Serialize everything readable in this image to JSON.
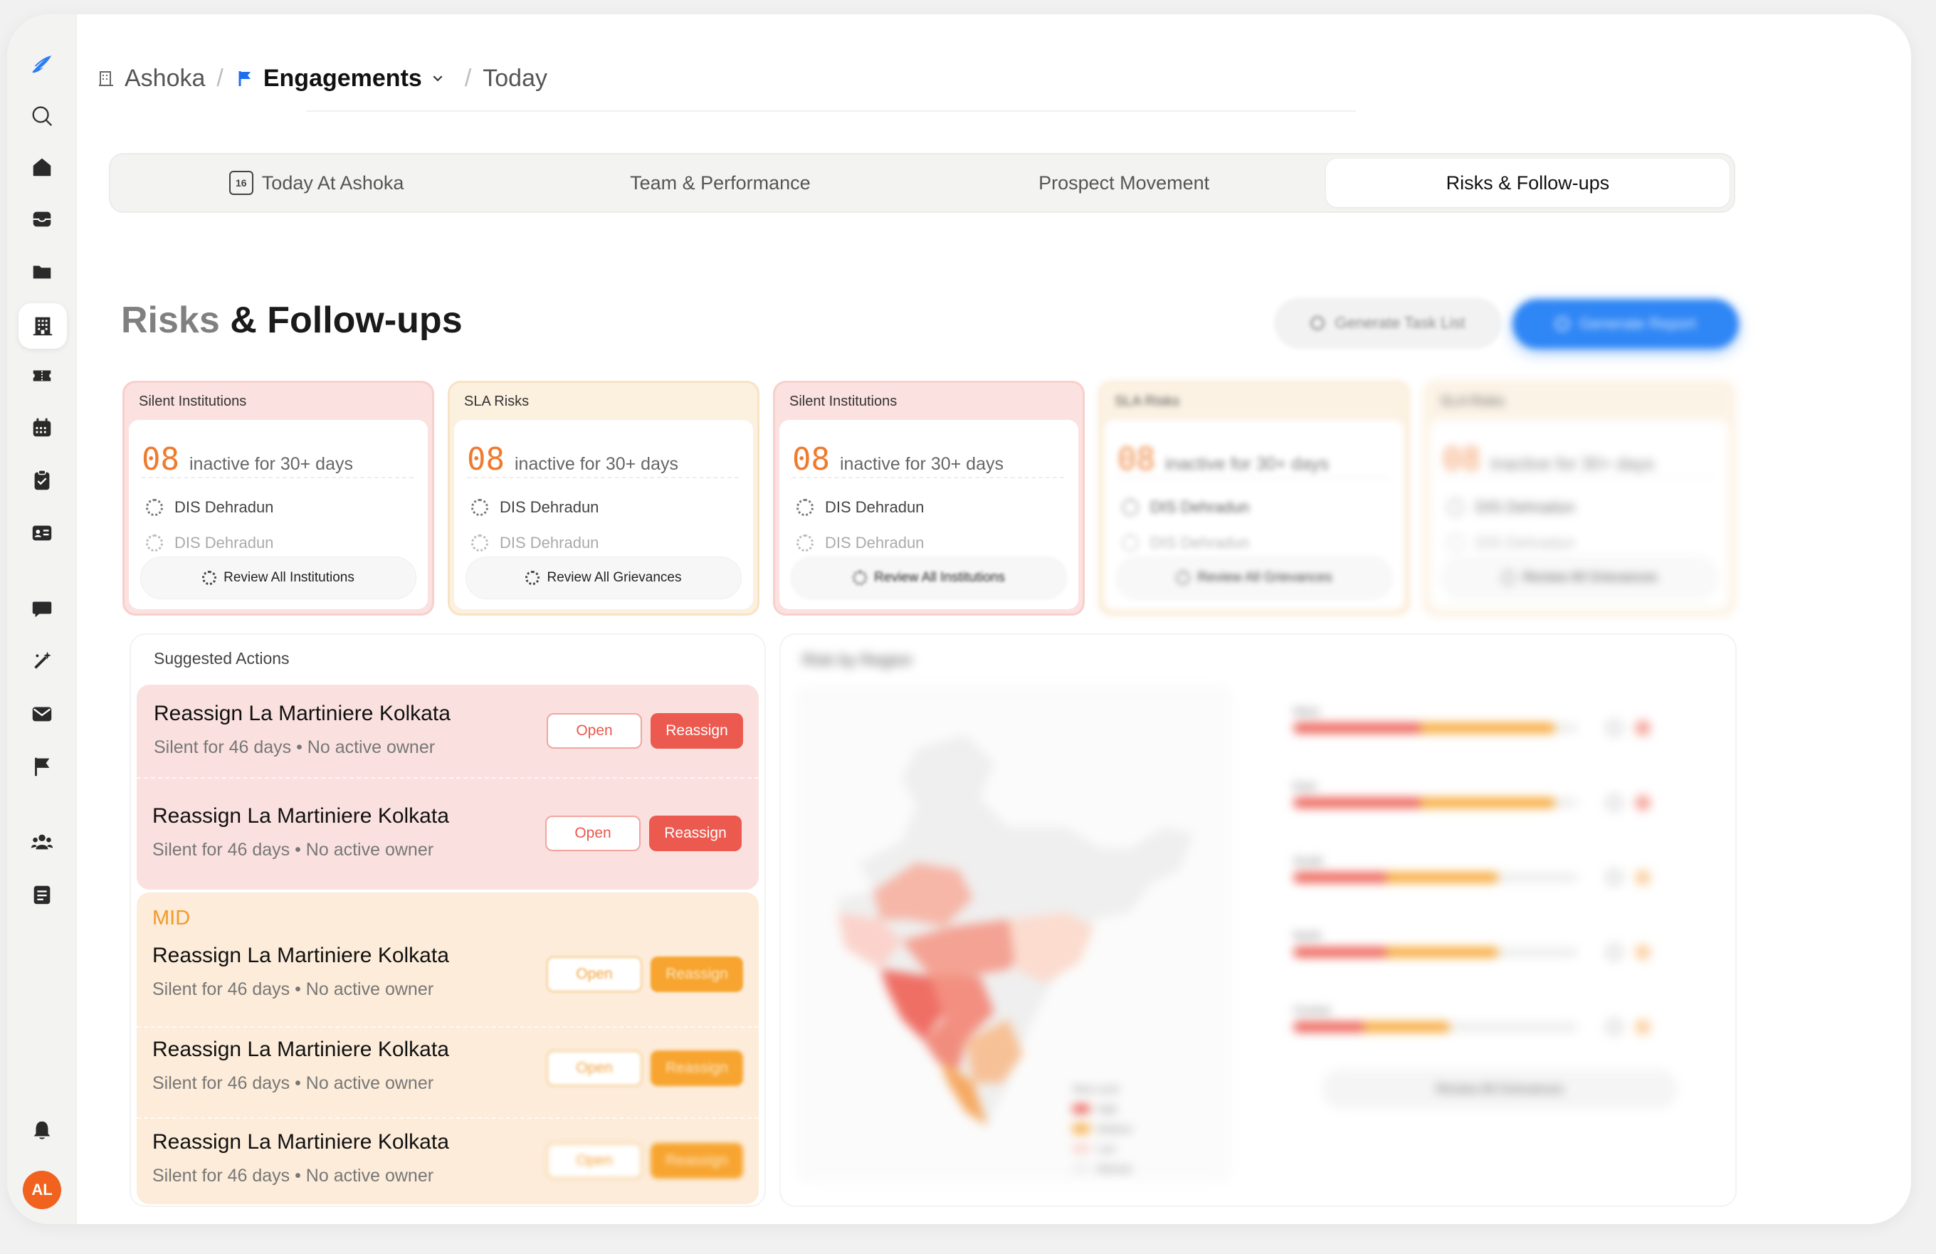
{
  "breadcrumb": {
    "org": "Ashoka",
    "section": "Engagements",
    "page": "Today"
  },
  "tabs": [
    {
      "label": "Today At Ashoka",
      "icon_text": "16"
    },
    {
      "label": "Team & Performance"
    },
    {
      "label": "Prospect Movement"
    },
    {
      "label": "Risks & Follow-ups"
    }
  ],
  "active_tab": "Risks & Follow-ups",
  "page_title": {
    "part1": "Risks",
    "part2": "& Follow-ups"
  },
  "actions": {
    "generate_task_list": "Generate Task List",
    "generate_report": "Generate Report"
  },
  "risk_cards": [
    {
      "title": "Silent Institutions",
      "count": "08",
      "stat_text": "inactive for 30+ days",
      "items": [
        "DIS Dehradun",
        "DIS Dehradun"
      ],
      "button": "Review All Institutions",
      "tone": "pink"
    },
    {
      "title": "SLA Risks",
      "count": "08",
      "stat_text": "inactive for 30+ days",
      "items": [
        "DIS Dehradun",
        "DIS Dehradun"
      ],
      "button": "Review All Grievances",
      "tone": "amber"
    },
    {
      "title": "Silent Institutions",
      "count": "08",
      "stat_text": "inactive for 30+ days",
      "items": [
        "DIS Dehradun",
        "DIS Dehradun"
      ],
      "button": "Review All Institutions",
      "tone": "pink"
    },
    {
      "title": "SLA Risks",
      "count": "08",
      "stat_text": "inactive for 30+ days",
      "items": [
        "DIS Dehradun",
        "DIS Dehradun"
      ],
      "button": "Review All Grievances",
      "tone": "amber"
    },
    {
      "title": "SLA Risks",
      "count": "08",
      "stat_text": "inactive for 30+ days",
      "items": [
        "DIS Dehradun",
        "DIS Dehradun"
      ],
      "button": "Review All Grievances",
      "tone": "amber"
    }
  ],
  "suggested": {
    "title": "Suggested Actions",
    "mid_label": "MID",
    "open_label": "Open",
    "reassign_label": "Reassign",
    "high_rows": [
      {
        "title": "Reassign La Martiniere Kolkata",
        "subtitle": "Silent for 46 days • No active owner"
      },
      {
        "title": "Reassign La Martiniere Kolkata",
        "subtitle": "Silent for 46 days • No active owner"
      }
    ],
    "mid_rows": [
      {
        "title": "Reassign La Martiniere Kolkata",
        "subtitle": "Silent for 46 days • No active owner"
      },
      {
        "title": "Reassign La Martiniere Kolkata",
        "subtitle": "Silent for 46 days • No active owner"
      },
      {
        "title": "Reassign La Martiniere Kolkata",
        "subtitle": "Silent for 46 days • No active owner"
      }
    ]
  },
  "region": {
    "title": "Risk by Region",
    "review_button": "Review All Grievances",
    "legend_title": "Risk Level",
    "legend": [
      "High",
      "Medium",
      "Low",
      "Minimal"
    ],
    "bars": [
      {
        "label": "West",
        "red": 0.45,
        "amber": 0.92
      },
      {
        "label": "East",
        "red": 0.45,
        "amber": 0.92
      },
      {
        "label": "South",
        "red": 0.33,
        "amber": 0.72
      },
      {
        "label": "North",
        "red": 0.33,
        "amber": 0.72
      },
      {
        "label": "Central",
        "red": 0.25,
        "amber": 0.55
      }
    ]
  },
  "user": {
    "initials": "AL"
  },
  "colors": {
    "accent_red": "#ec5a4f",
    "accent_amber": "#f7a530",
    "accent_blue": "#2f86f5",
    "orange_number": "#f07b2f"
  }
}
